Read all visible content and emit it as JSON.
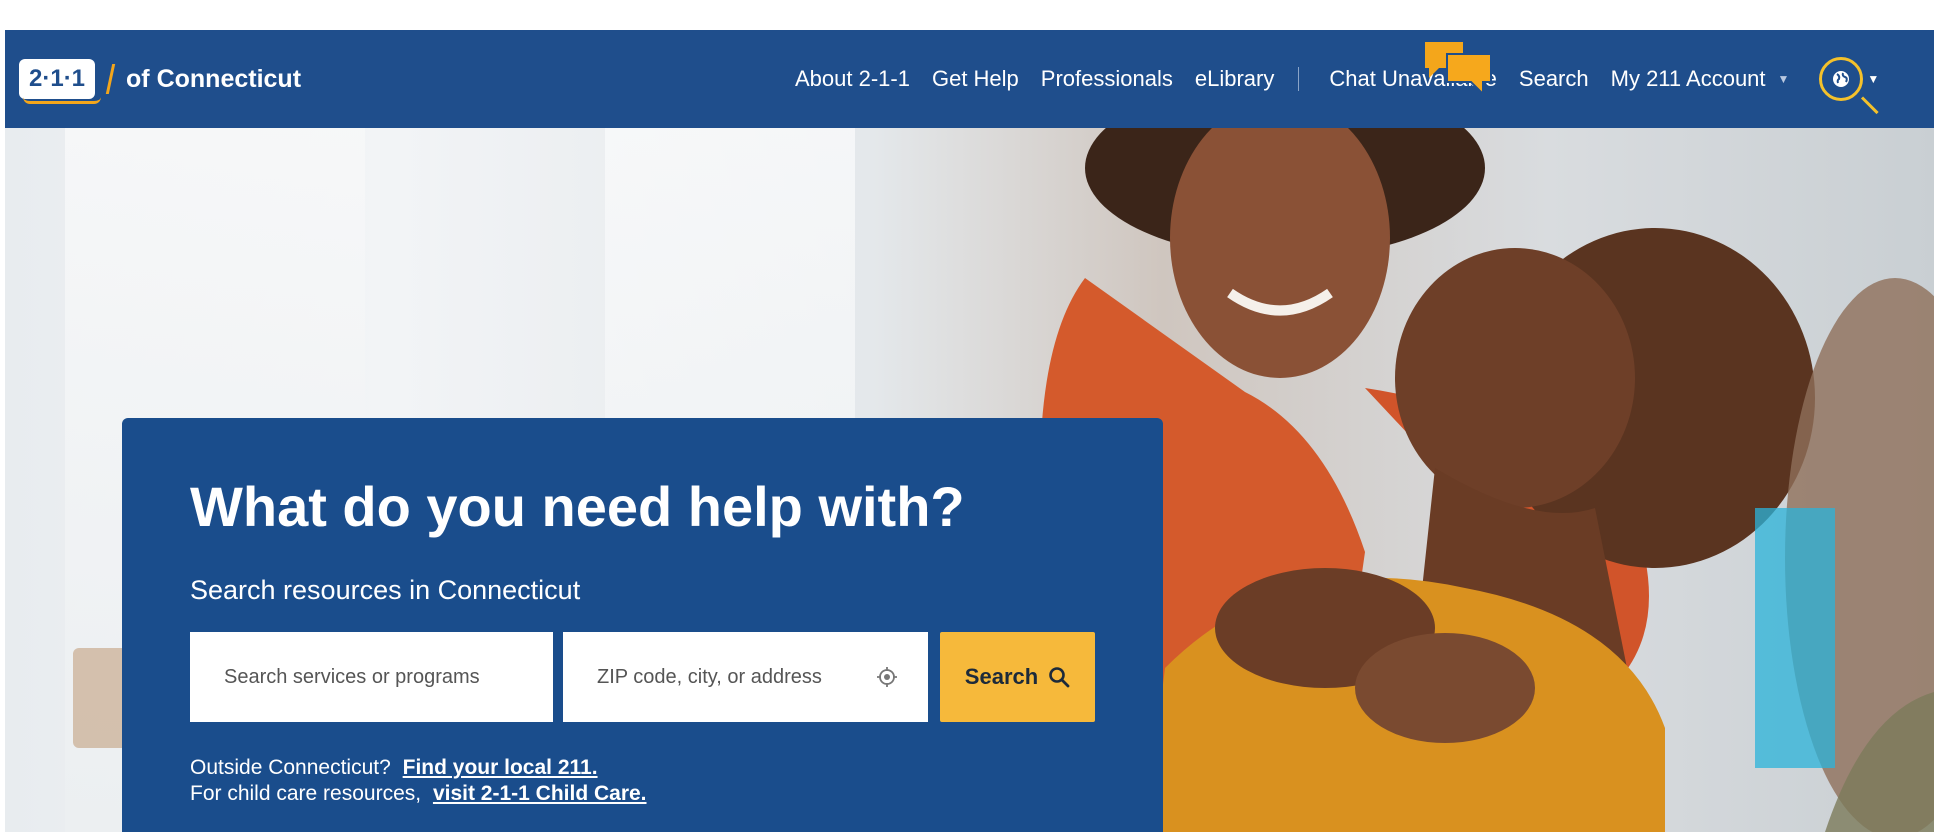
{
  "header": {
    "logo_number": "2·1·1",
    "logo_text": "of Connecticut",
    "nav": {
      "about": "About 2-1-1",
      "get_help": "Get Help",
      "professionals": "Professionals",
      "elibrary": "eLibrary",
      "chat": "Chat Unavailable",
      "search": "Search",
      "account": "My 211 Account"
    }
  },
  "hero": {
    "title": "What do you need help with?",
    "subtitle": "Search resources in Connecticut",
    "services_placeholder": "Search services or programs",
    "location_placeholder": "ZIP code, city, or address",
    "search_button": "Search",
    "outside_text": "Outside Connecticut?",
    "outside_link": "Find your local 211.",
    "childcare_text": "For child care resources,",
    "childcare_link": "visit 2-1-1 Child Care."
  },
  "colors": {
    "brand_blue": "#1f4e8c",
    "card_blue": "#1a4d8c",
    "accent_yellow": "#f6b93b",
    "chat_icon": "#f4a61b"
  },
  "icons": [
    "chat-bubbles-icon",
    "globe-icon",
    "chevron-down-icon",
    "location-target-icon",
    "search-icon"
  ]
}
